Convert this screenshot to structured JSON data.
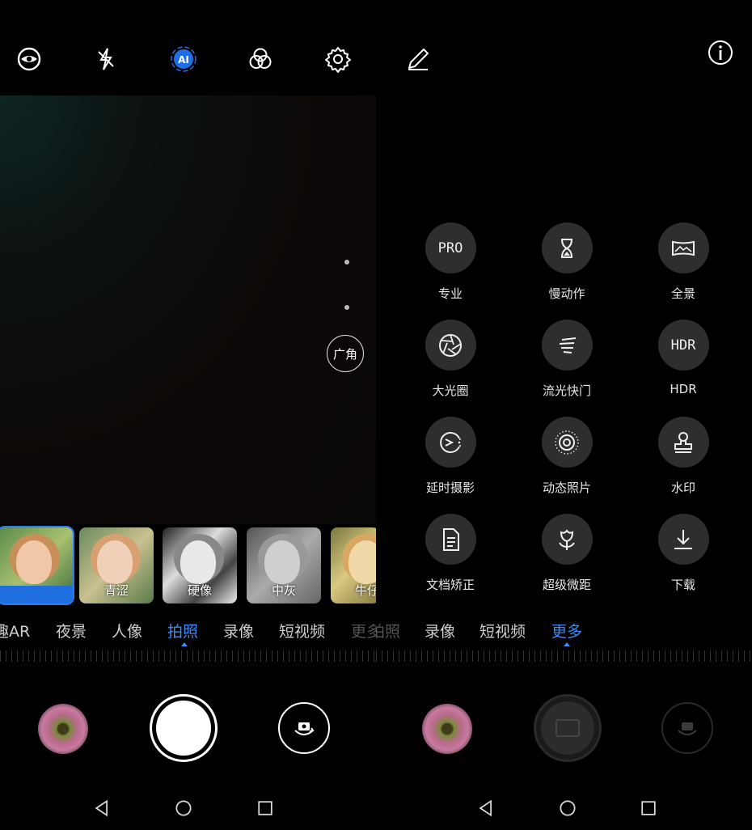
{
  "left": {
    "top_icons": [
      "eye-icon",
      "flash-off-icon",
      "ai-icon",
      "color-filter-icon",
      "settings-gear-icon",
      "beauty-pen-icon"
    ],
    "zoom_label": "广角",
    "filters": [
      {
        "label": "",
        "selected": true
      },
      {
        "label": "青涩",
        "selected": false
      },
      {
        "label": "硬像",
        "selected": false
      },
      {
        "label": "中灰",
        "selected": false
      },
      {
        "label": "牛仔",
        "selected": false
      }
    ],
    "modes": [
      "趣AR",
      "夜景",
      "人像",
      "拍照",
      "录像",
      "短视频",
      "更多"
    ],
    "active_mode": "拍照"
  },
  "right": {
    "top_icons": [
      "info-icon"
    ],
    "more_modes": [
      {
        "label": "专业",
        "icon": "pro-icon",
        "icon_text": "PRO"
      },
      {
        "label": "慢动作",
        "icon": "hourglass-icon",
        "icon_text": ""
      },
      {
        "label": "全景",
        "icon": "panorama-icon",
        "icon_text": ""
      },
      {
        "label": "大光圈",
        "icon": "aperture-icon",
        "icon_text": ""
      },
      {
        "label": "流光快门",
        "icon": "light-trail-icon",
        "icon_text": ""
      },
      {
        "label": "HDR",
        "icon": "hdr-icon",
        "icon_text": "HDR"
      },
      {
        "label": "延时摄影",
        "icon": "timelapse-icon",
        "icon_text": ""
      },
      {
        "label": "动态照片",
        "icon": "moving-picture-icon",
        "icon_text": ""
      },
      {
        "label": "水印",
        "icon": "watermark-stamp-icon",
        "icon_text": ""
      },
      {
        "label": "文档矫正",
        "icon": "document-icon",
        "icon_text": ""
      },
      {
        "label": "超级微距",
        "icon": "flower-macro-icon",
        "icon_text": ""
      },
      {
        "label": "下载",
        "icon": "download-icon",
        "icon_text": ""
      }
    ],
    "modes": [
      "拍照",
      "录像",
      "短视频",
      "更多"
    ],
    "active_mode": "更多"
  },
  "colors": {
    "accent": "#3a8cff",
    "background": "#000000",
    "circle_bg": "#2e2e2e"
  }
}
